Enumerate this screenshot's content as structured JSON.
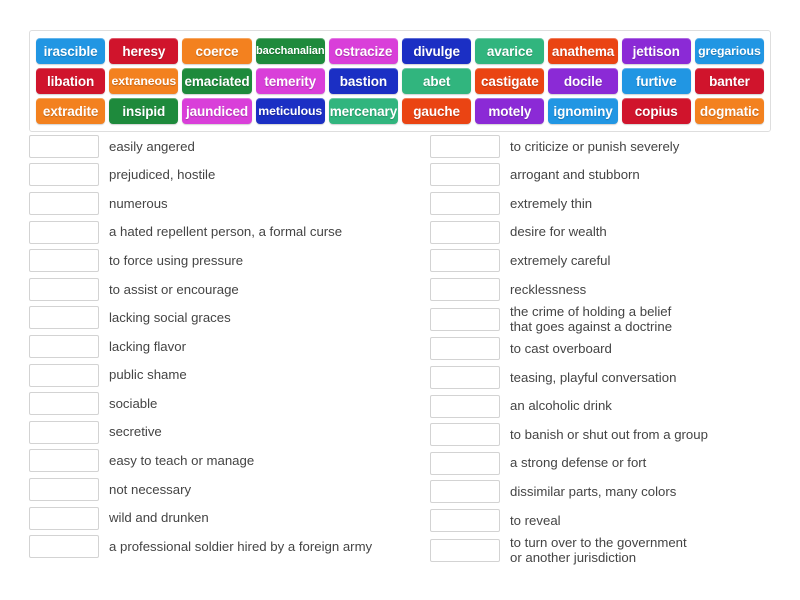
{
  "activity": {
    "type": "match-up",
    "title": "Match up"
  },
  "word_bank": {
    "rows": [
      [
        {
          "label": "irascible",
          "color": "#2196e3"
        },
        {
          "label": "heresy",
          "color": "#d0142c"
        },
        {
          "label": "coerce",
          "color": "#f3811f"
        },
        {
          "label": "bacchanalian",
          "color": "#1e8a3c"
        },
        {
          "label": "ostracize",
          "color": "#d93fd9"
        },
        {
          "label": "divulge",
          "color": "#1b2fc4"
        },
        {
          "label": "avarice",
          "color": "#31b57e"
        },
        {
          "label": "anathema",
          "color": "#ea4413"
        },
        {
          "label": "jettison",
          "color": "#8b2ad6"
        },
        {
          "label": "gregarious",
          "color": "#2196e3"
        }
      ],
      [
        {
          "label": "libation",
          "color": "#d0142c"
        },
        {
          "label": "extraneous",
          "color": "#f3811f"
        },
        {
          "label": "emaciated",
          "color": "#1e8a3c"
        },
        {
          "label": "temerity",
          "color": "#d93fd9"
        },
        {
          "label": "bastion",
          "color": "#1b2fc4"
        },
        {
          "label": "abet",
          "color": "#31b57e"
        },
        {
          "label": "castigate",
          "color": "#ea4413"
        },
        {
          "label": "docile",
          "color": "#8b2ad6"
        },
        {
          "label": "furtive",
          "color": "#2196e3"
        },
        {
          "label": "banter",
          "color": "#d0142c"
        }
      ],
      [
        {
          "label": "extradite",
          "color": "#f3811f"
        },
        {
          "label": "insipid",
          "color": "#1e8a3c"
        },
        {
          "label": "jaundiced",
          "color": "#d93fd9"
        },
        {
          "label": "meticulous",
          "color": "#1b2fc4"
        },
        {
          "label": "mercenary",
          "color": "#31b57e"
        },
        {
          "label": "gauche",
          "color": "#ea4413"
        },
        {
          "label": "motely",
          "color": "#8b2ad6"
        },
        {
          "label": "ignominy",
          "color": "#2196e3"
        },
        {
          "label": "copius",
          "color": "#d0142c"
        },
        {
          "label": "dogmatic",
          "color": "#f3811f"
        }
      ]
    ]
  },
  "definitions": {
    "left_column": [
      {
        "answer": "",
        "text": "easily angered"
      },
      {
        "answer": "",
        "text": "prejudiced, hostile"
      },
      {
        "answer": "",
        "text": "numerous"
      },
      {
        "answer": "",
        "text": "a hated repellent person, a formal curse"
      },
      {
        "answer": "",
        "text": "to force using pressure"
      },
      {
        "answer": "",
        "text": "to assist or encourage"
      },
      {
        "answer": "",
        "text": "lacking social graces"
      },
      {
        "answer": "",
        "text": "lacking flavor"
      },
      {
        "answer": "",
        "text": "public shame"
      },
      {
        "answer": "",
        "text": "sociable"
      },
      {
        "answer": "",
        "text": "secretive"
      },
      {
        "answer": "",
        "text": "easy to teach or manage"
      },
      {
        "answer": "",
        "text": "not necessary"
      },
      {
        "answer": "",
        "text": "wild and drunken"
      },
      {
        "answer": "",
        "text": "a professional soldier hired by a foreign army"
      }
    ],
    "right_column": [
      {
        "answer": "",
        "text": "to criticize or punish severely"
      },
      {
        "answer": "",
        "text": "arrogant and stubborn"
      },
      {
        "answer": "",
        "text": "extremely thin"
      },
      {
        "answer": "",
        "text": "desire for wealth"
      },
      {
        "answer": "",
        "text": "extremely careful"
      },
      {
        "answer": "",
        "text": "recklessness"
      },
      {
        "answer": "",
        "text": "the crime of holding a belief\nthat goes against a doctrine"
      },
      {
        "answer": "",
        "text": "to cast overboard"
      },
      {
        "answer": "",
        "text": "teasing, playful conversation"
      },
      {
        "answer": "",
        "text": "an alcoholic drink"
      },
      {
        "answer": "",
        "text": "to banish or shut out from a group"
      },
      {
        "answer": "",
        "text": "a strong defense or fort"
      },
      {
        "answer": "",
        "text": "dissimilar parts, many colors"
      },
      {
        "answer": "",
        "text": "to reveal"
      },
      {
        "answer": "",
        "text": "to turn over to the government\nor another jurisdiction"
      }
    ]
  },
  "colors": {
    "page_background": "#ffffff",
    "bank_border": "#dedede",
    "drop_box_border": "#d3d3d3",
    "definition_text": "#444444"
  }
}
